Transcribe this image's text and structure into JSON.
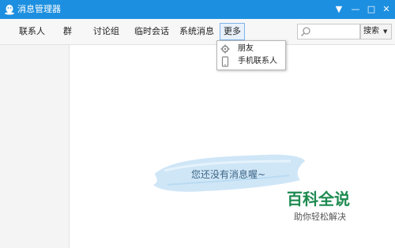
{
  "window": {
    "title": "消息管理器",
    "minimize_icon": "dropdown-triangle-icon",
    "min_label": "—",
    "max_label": "□",
    "close_label": "✕",
    "accent": "#1d8fe0"
  },
  "nav": {
    "tabs": [
      {
        "label": "联系人"
      },
      {
        "label": "群"
      },
      {
        "label": "讨论组"
      },
      {
        "label": "临时会话"
      },
      {
        "label": "系统消息"
      }
    ],
    "more_label": "更多"
  },
  "search": {
    "placeholder": "",
    "button_label": "搜索"
  },
  "dropdown": {
    "items": [
      {
        "label": "朋友",
        "icon": "gear-icon"
      },
      {
        "label": "手机联系人",
        "icon": "phone-icon"
      }
    ]
  },
  "empty": {
    "message": "您还没有消息喔~"
  },
  "watermark": {
    "logo": "百科全说",
    "sub": "助你轻松解决"
  }
}
